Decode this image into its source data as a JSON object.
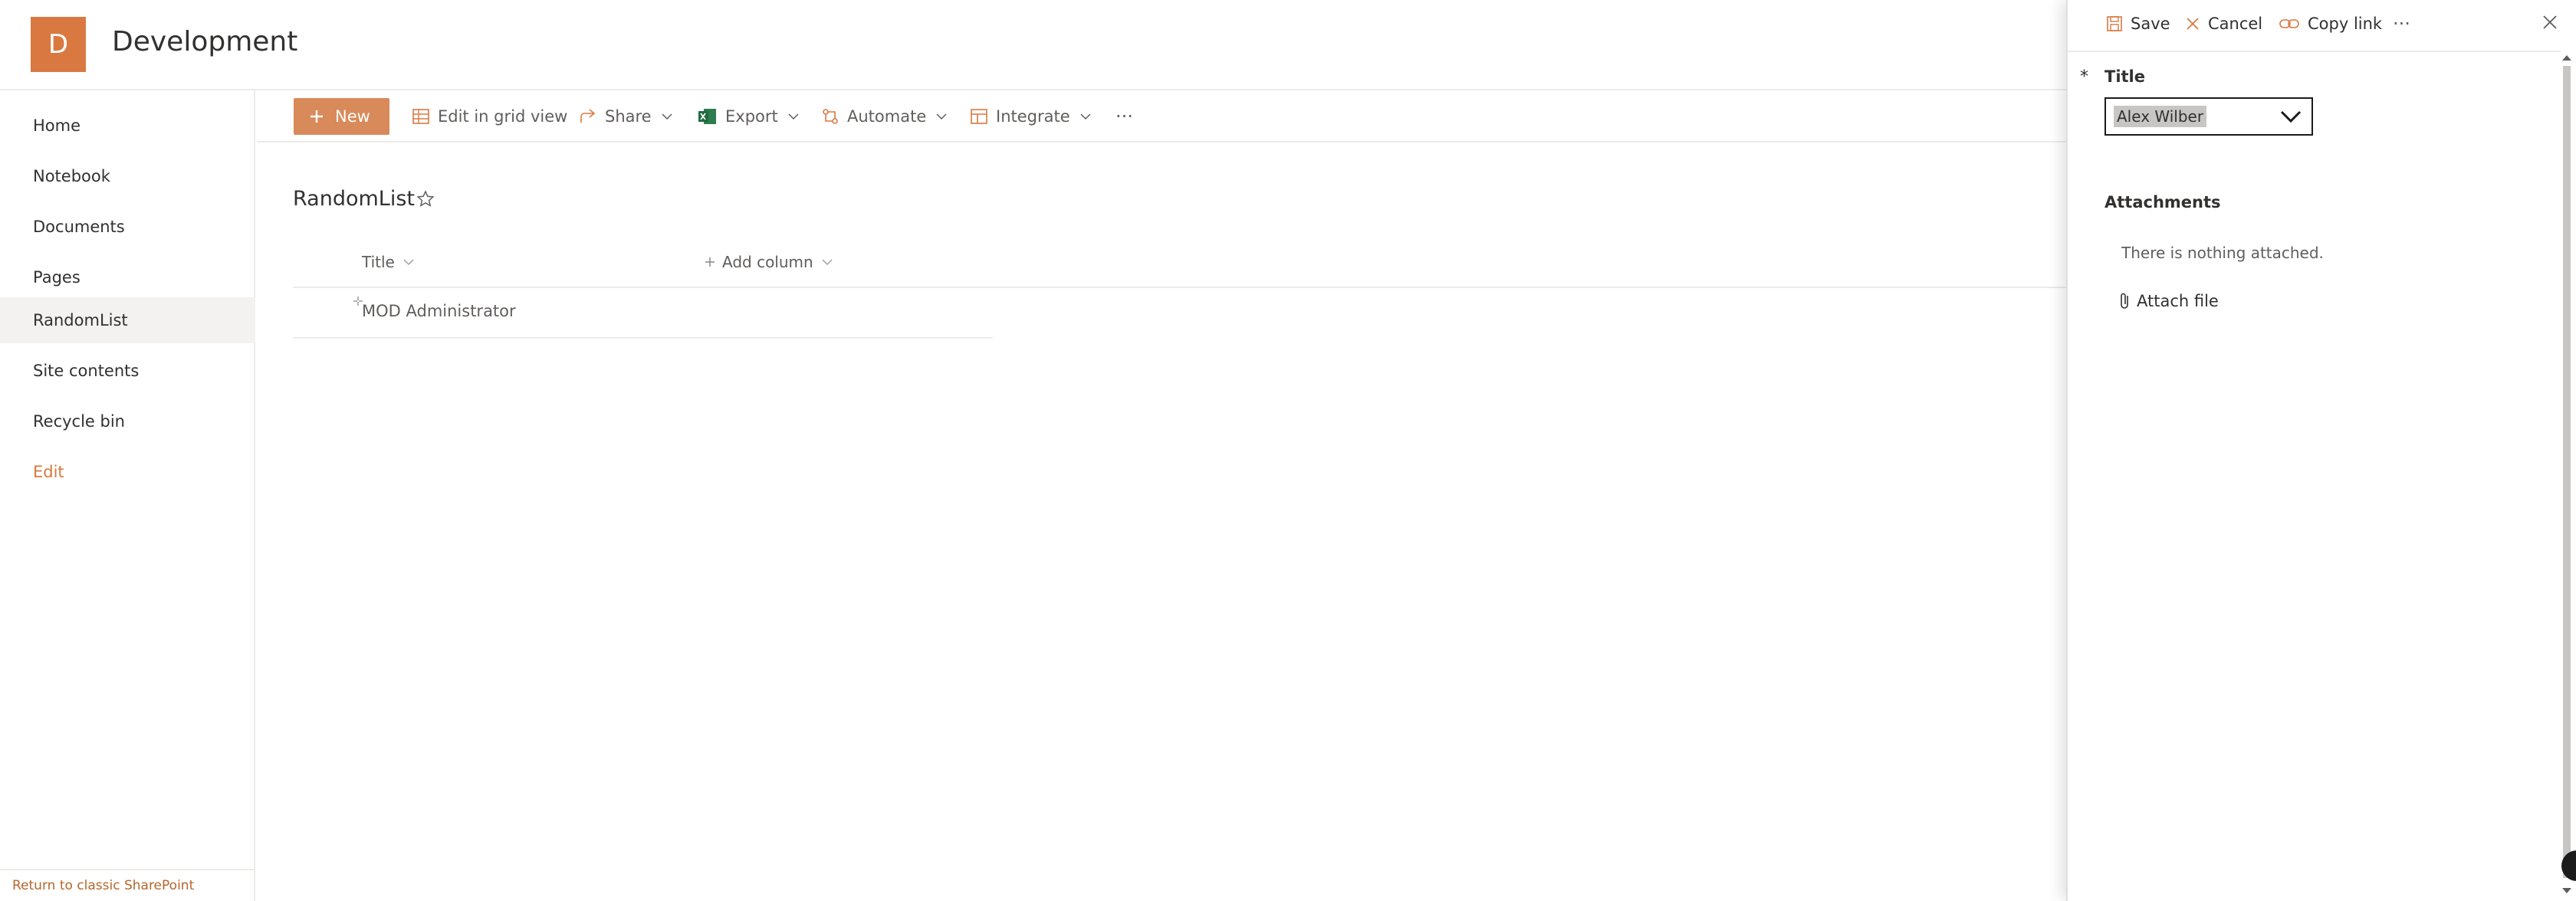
{
  "site": {
    "logo_letter": "D",
    "title": "Development"
  },
  "nav": {
    "items": [
      {
        "label": "Home"
      },
      {
        "label": "Notebook"
      },
      {
        "label": "Documents"
      },
      {
        "label": "Pages"
      },
      {
        "label": "RandomList",
        "selected": true
      },
      {
        "label": "Site contents"
      },
      {
        "label": "Recycle bin"
      }
    ],
    "edit_label": "Edit",
    "return_label": "Return to classic SharePoint"
  },
  "commandbar": {
    "new_label": "New",
    "edit_grid_label": "Edit in grid view",
    "share_label": "Share",
    "export_label": "Export",
    "automate_label": "Automate",
    "integrate_label": "Integrate",
    "more_label": "···"
  },
  "list": {
    "title": "RandomList",
    "columns": [
      "Title",
      "Add column"
    ],
    "rows": [
      {
        "title": "MOD Administrator"
      }
    ]
  },
  "panel": {
    "save_label": "Save",
    "cancel_label": "Cancel",
    "copy_link_label": "Copy link",
    "more_label": "···",
    "required_marker": "*",
    "title_field_label": "Title",
    "title_value": "Alex Wilber",
    "attachments_label": "Attachments",
    "nothing_attached": "There is nothing attached.",
    "attach_file_label": "Attach file"
  },
  "colors": {
    "accent": "#d97941",
    "new_button": "#d98a5a"
  }
}
